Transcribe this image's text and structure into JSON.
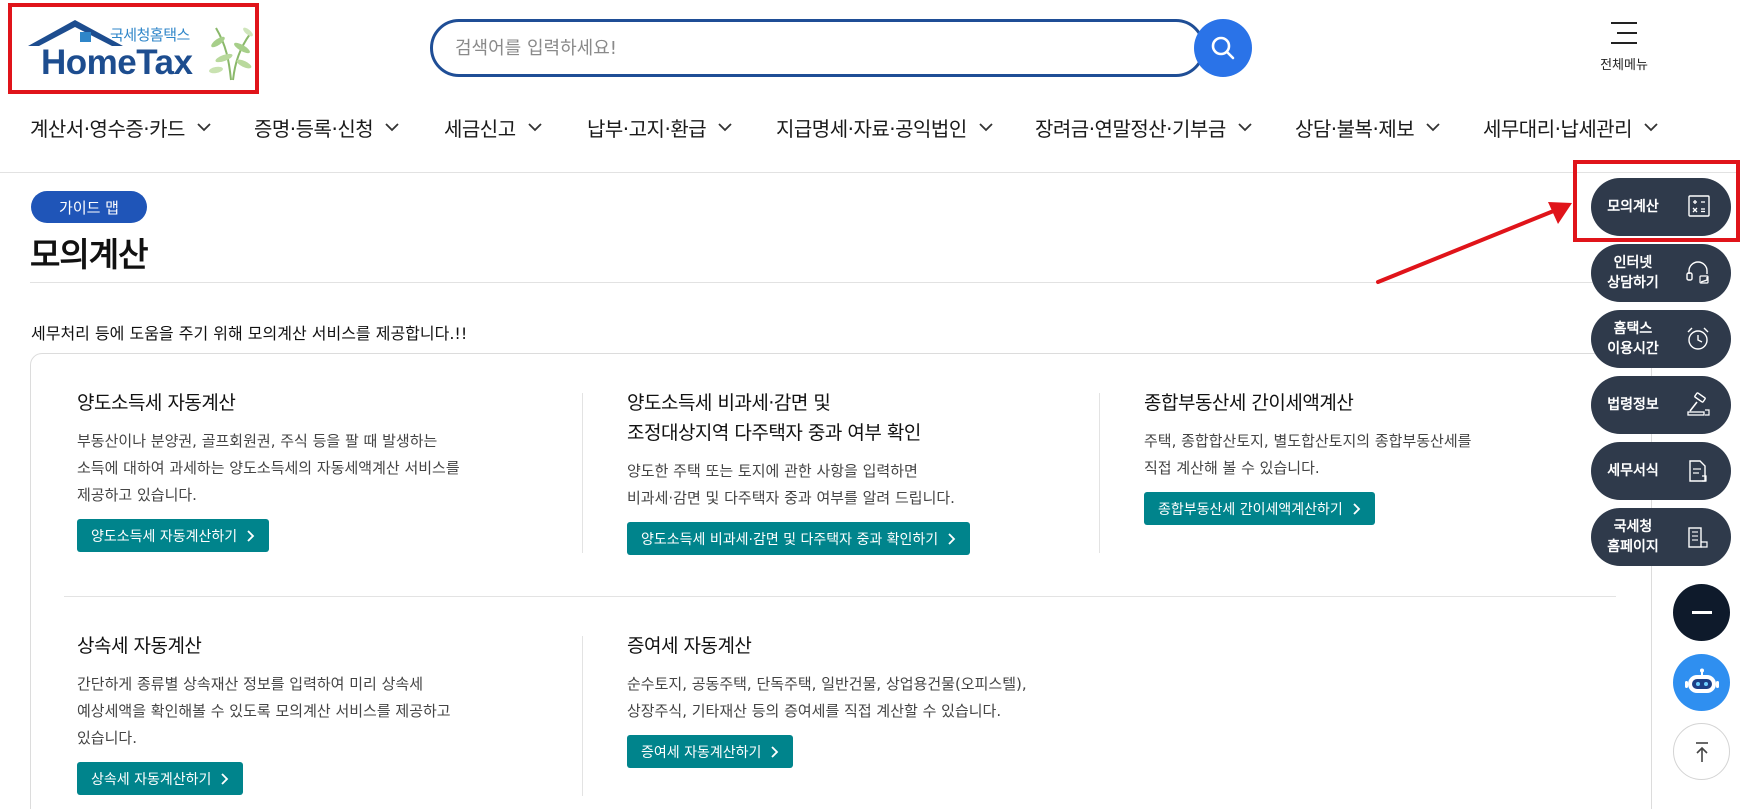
{
  "header": {
    "logo_sub": "국세청홈택스",
    "logo_main": "HomeTax",
    "search_placeholder": "검색어를 입력하세요!",
    "search_value": "",
    "allmenu_label": "전체메뉴"
  },
  "gnb": [
    {
      "label": "계산서·영수증·카드"
    },
    {
      "label": "증명·등록·신청"
    },
    {
      "label": "세금신고"
    },
    {
      "label": "납부·고지·환급"
    },
    {
      "label": "지급명세·자료·공익법인"
    },
    {
      "label": "장려금·연말정산·기부금"
    },
    {
      "label": "상담·불복·제보"
    },
    {
      "label": "세무대리·납세관리"
    }
  ],
  "page": {
    "badge": "가이드 맵",
    "title": "모의계산",
    "intro": "세무처리 등에 도움을 주기 위해 모의계산 서비스를 제공합니다.!!"
  },
  "cards": [
    {
      "title1": "양도소득세 자동계산",
      "title2": "",
      "desc1": "부동산이나 분양권, 골프회원권, 주식 등을 팔 때 발생하는",
      "desc2": "소득에 대하여 과세하는 양도소득세의 자동세액계산 서비스를",
      "desc3": "제공하고 있습니다.",
      "button": "양도소득세 자동계산하기"
    },
    {
      "title1": "양도소득세 비과세·감면 및",
      "title2": "조정대상지역 다주택자 중과 여부 확인",
      "desc1": "양도한 주택 또는 토지에 관한 사항을 입력하면",
      "desc2": "비과세·감면 및 다주택자 중과 여부를 알려 드립니다.",
      "desc3": "",
      "button": "양도소득세 비과세·감면 및 다주택자 중과 확인하기"
    },
    {
      "title1": "종합부동산세 간이세액계산",
      "title2": "",
      "desc1": "주택, 종합합산토지, 별도합산토지의 종합부동산세를",
      "desc2": "직접 계산해 볼 수 있습니다.",
      "desc3": "",
      "button": "종합부동산세 간이세액계산하기"
    },
    {
      "title1": "상속세 자동계산",
      "title2": "",
      "desc1": "간단하게 종류별 상속재산 정보를 입력하여 미리 상속세",
      "desc2": "예상세액을 확인해볼 수 있도록 모의계산 서비스를 제공하고",
      "desc3": "있습니다.",
      "button": "상속세 자동계산하기"
    },
    {
      "title1": "증여세 자동계산",
      "title2": "",
      "desc1": "순수토지, 공동주택, 단독주택, 일반건물, 상업용건물(오피스텔),",
      "desc2": "상장주식, 기타재산 등의 증여세를 직접 계산할 수 있습니다.",
      "desc3": "",
      "button": "증여세 자동계산하기"
    }
  ],
  "quick_menu": [
    {
      "line1": "모의계산",
      "line2": "",
      "icon": "calculator-icon"
    },
    {
      "line1": "인터넷",
      "line2": "상담하기",
      "icon": "headset-icon"
    },
    {
      "line1": "홈택스",
      "line2": "이용시간",
      "icon": "alarm-clock-icon"
    },
    {
      "line1": "법령정보",
      "line2": "",
      "icon": "gavel-icon"
    },
    {
      "line1": "세무서식",
      "line2": "",
      "icon": "document-icon"
    },
    {
      "line1": "국세청",
      "line2": "홈페이지",
      "icon": "building-icon"
    }
  ],
  "colors": {
    "brand_navy": "#1d4d8f",
    "search_button": "#2a73e8",
    "badge": "#1f55b8",
    "card_button": "#00848c",
    "quick_menu": "#2f3a4b",
    "highlight_red": "#e0141a",
    "chatbot": "#2f8ff0"
  }
}
